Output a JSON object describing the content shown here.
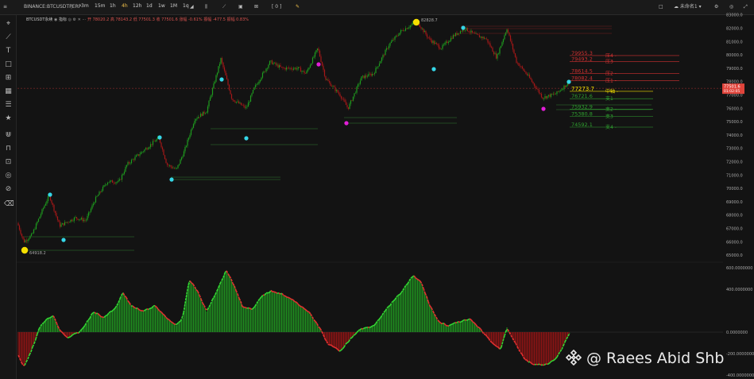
{
  "symbol": "BINANCE:BTCUSDTPERP",
  "timeframes": [
    "3m",
    "15m",
    "1h",
    "4h",
    "12h",
    "1d",
    "1w",
    "1M",
    "1q"
  ],
  "selected_timeframe": "4h",
  "bracket_label": "[ 0 ]",
  "layout_menu": "未命名1",
  "legend": {
    "symbol": "BTCUSDT永续",
    "suffix": "指标",
    "values": "开 78020.2  高 78143.2  低 77501.3  收 77501.6  涨幅 -0.61%  振幅 -477.5  振幅 0.83%"
  },
  "price_axis": [
    "83000.0",
    "82000.0",
    "81000.0",
    "80000.0",
    "79000.0",
    "78000.0",
    "77000.0",
    "76000.0",
    "75000.0",
    "74000.0",
    "73000.0",
    "72000.0",
    "71000.0",
    "70000.0",
    "69000.0",
    "68000.0",
    "67000.0",
    "66000.0",
    "65000.0"
  ],
  "current_price": {
    "price": "77501.6",
    "timer": "01:02:05"
  },
  "high_marker": "82828.7",
  "low_marker": "64918.2",
  "levels": [
    {
      "value": "79955.3",
      "label": "压4",
      "type": "res"
    },
    {
      "value": "79493.2",
      "label": "压3",
      "type": "res"
    },
    {
      "value": "78614.5",
      "label": "压2",
      "type": "res"
    },
    {
      "value": "78082.4",
      "label": "压1",
      "type": "res"
    },
    {
      "value": "77273.7",
      "label": "中轴",
      "type": "mid"
    },
    {
      "value": "76721.6",
      "label": "支1",
      "type": "sup"
    },
    {
      "value": "75932.9",
      "label": "支2",
      "type": "sup"
    },
    {
      "value": "75380.8",
      "label": "支3",
      "type": "sup"
    },
    {
      "value": "74592.1",
      "label": "支4",
      "type": "sup"
    }
  ],
  "indicator_axis": [
    "600.0000000",
    "400.0000000",
    "0.0000000",
    "-200.0000000",
    "-400.0000000"
  ],
  "watermark": "@ Raees Abid Shb",
  "colors": {
    "up": "#1e9c1e",
    "down": "#a51818",
    "cyan": "#35d7e8",
    "magenta": "#e21ed8",
    "yellow": "#f5e000",
    "price_tag": "#e0443b"
  }
}
